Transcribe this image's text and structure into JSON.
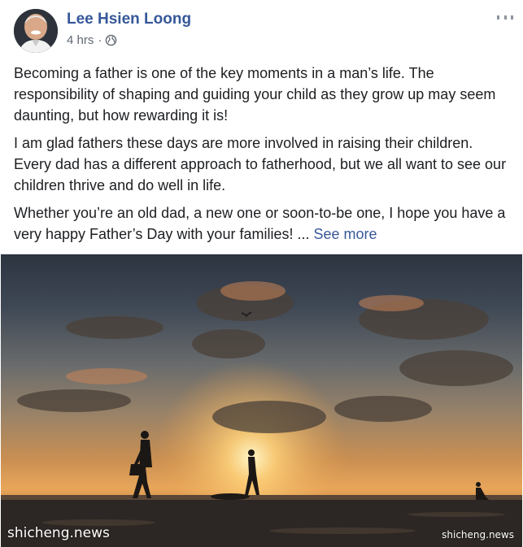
{
  "post": {
    "author": "Lee Hsien Loong",
    "time": "4 hrs",
    "separator": "·",
    "paragraphs": [
      "Becoming a father is one of the key moments in a man’s life. The responsibility of shaping and guiding your child as they grow up may seem daunting, but how rewarding it is!",
      "I am glad fathers these days are more involved in raising their children. Every dad has a different approach to fatherhood, but we all want to see our children thrive and do well in life."
    ],
    "last_paragraph": "Whether you’re an old dad, a new one or soon-to-be one, I hope you have a very happy Father’s Day with your families! ...",
    "see_more": "See more",
    "privacy_icon": "globe-icon",
    "options_icon": "more-options-icon"
  },
  "photo": {
    "watermark_left": "shicheng.news",
    "watermark_right": "shicheng.news"
  }
}
